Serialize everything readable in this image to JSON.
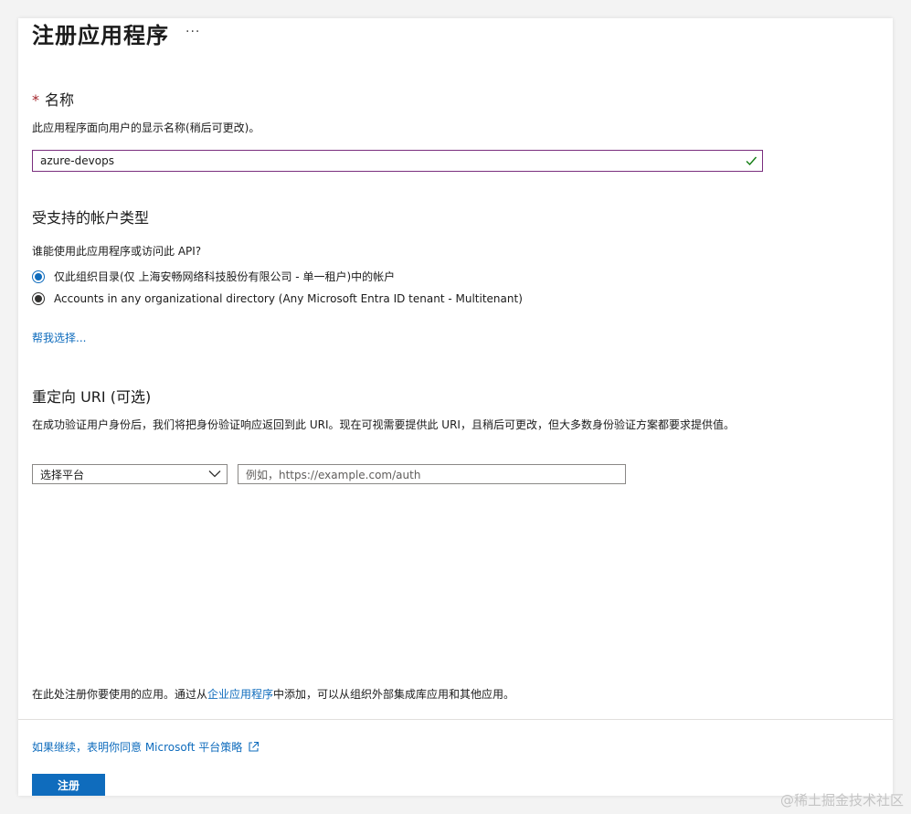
{
  "page": {
    "title": "注册应用程序",
    "more_label": "···"
  },
  "name_section": {
    "required_mark": "*",
    "label": "名称",
    "description": "此应用程序面向用户的显示名称(稍后可更改)。",
    "value": "azure-devops",
    "valid_icon": "check-icon"
  },
  "account_types": {
    "label": "受支持的帐户类型",
    "question": "谁能使用此应用程序或访问此 API?",
    "options": [
      {
        "label": "仅此组织目录(仅 上海安畅网络科技股份有限公司 - 单一租户)中的帐户",
        "selected": true
      },
      {
        "label": "Accounts in any organizational directory (Any Microsoft Entra ID tenant - Multitenant)",
        "selected": false
      }
    ],
    "help_link": "帮我选择..."
  },
  "redirect": {
    "label": "重定向 URI (可选)",
    "description": "在成功验证用户身份后，我们将把身份验证响应返回到此 URI。现在可视需要提供此 URI，且稍后可更改，但大多数身份验证方案都要求提供值。",
    "platform_select": "选择平台",
    "uri_placeholder": "例如，https://example.com/auth"
  },
  "footer": {
    "note_prefix": "在此处注册你要使用的应用。通过从",
    "note_link": "企业应用程序",
    "note_suffix": "中添加，可以从组织外部集成库应用和其他应用。",
    "policy_link": "如果继续，表明你同意 Microsoft 平台策略",
    "register_button": "注册"
  },
  "watermark": "@稀土掘金技术社区",
  "colors": {
    "accent": "#0f6cbd",
    "input_focus_border": "#7a2e7e",
    "valid_check": "#107c10",
    "required": "#a4262c"
  }
}
